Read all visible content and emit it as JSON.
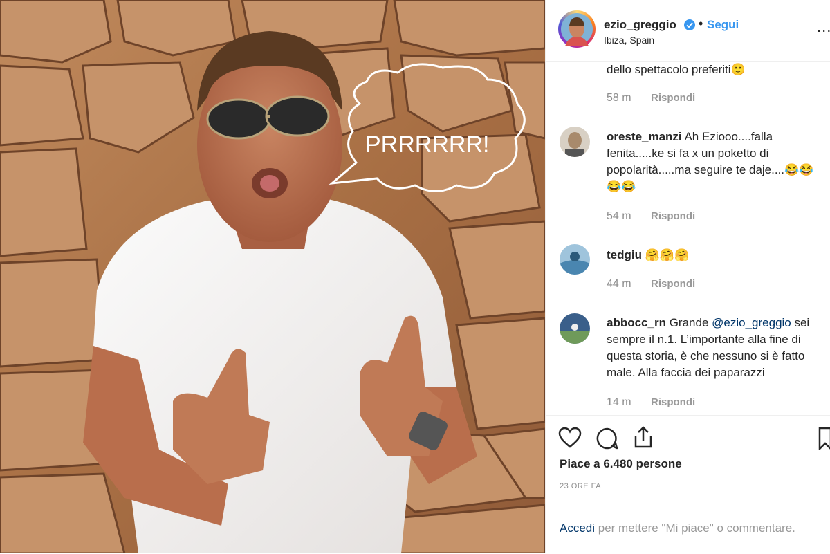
{
  "post": {
    "photo_caption_bubble": "PRRRRRR!",
    "header": {
      "username": "ezio_greggio",
      "separator": "•",
      "follow_label": "Segui",
      "location": "Ibiza, Spain",
      "more_label": "..."
    },
    "comments": [
      {
        "text": "dello spettacolo preferiti🙂",
        "ago": "58 m",
        "reply": "Rispondi"
      },
      {
        "user": "oreste_manzi",
        "text": " Ah Eziooo....falla fenita.....ke si fa x un poketto di popolarità.....ma seguire te daje....😂😂😂😂",
        "ago": "54 m",
        "reply": "Rispondi"
      },
      {
        "user": "tedgiu",
        "text": " 🤗🤗🤗",
        "ago": "44 m",
        "reply": "Rispondi"
      },
      {
        "user": "abbocc_rn",
        "text_before": " Grande ",
        "mention": "@ezio_greggio",
        "text_after": " sei sempre il n.1. L’importante alla fine di questa storia, è che nessuno si è fatto male. Alla faccia dei paparazzi",
        "ago": "14 m",
        "reply": "Rispondi"
      }
    ],
    "likes": "Piace a 6.480 persone",
    "timestamp": "23 ORE FA",
    "login": {
      "link": "Accedi",
      "rest": " per mettere \"Mi piace\" o commentare."
    },
    "colors": {
      "accent": "#3897f0",
      "link": "#003569",
      "muted": "#8e8e8e"
    },
    "icons": [
      "heart-icon",
      "comment-icon",
      "share-icon",
      "bookmark-icon",
      "verified-icon"
    ]
  }
}
